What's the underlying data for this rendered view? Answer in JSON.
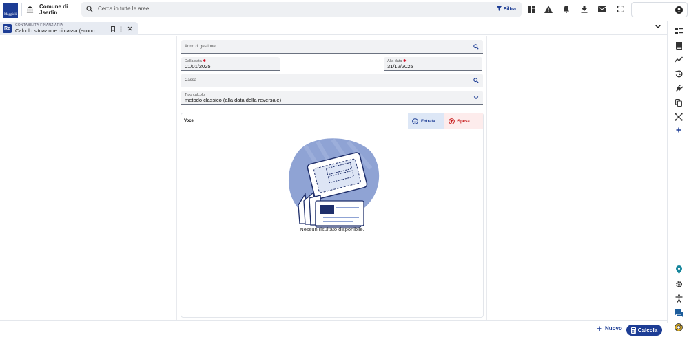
{
  "brand": {
    "logo_text": "Maggioli",
    "org_line1": "Comune di",
    "org_line2": "Jserfin"
  },
  "search": {
    "placeholder": "Cerca in tutte le aree...",
    "filter_label": "Filtra"
  },
  "tab": {
    "badge": "Re",
    "kicker": "CONTABILITÀ FINANZIARIA",
    "title": "Calcolo situazione di cassa (econo..."
  },
  "form": {
    "anno": {
      "label": "Anno di gestione",
      "value": ""
    },
    "dalla": {
      "label": "Dalla data",
      "value": "01/01/2025"
    },
    "alla": {
      "label": "Alla data",
      "value": "31/12/2025"
    },
    "cassa": {
      "label": "Cassa",
      "value": ""
    },
    "tipo": {
      "label": "Tipo calcolo",
      "value": "metodo classico (alla data della reversale)"
    }
  },
  "results": {
    "column_voce": "Voce",
    "toggle_entrata": "Entrata",
    "toggle_spesa": "Spesa",
    "empty_message": "Nessun risultato disponibile."
  },
  "actions": {
    "new_label": "Nuovo",
    "calc_label": "Calcola"
  },
  "colors": {
    "primary": "#1d3d95",
    "danger": "#c81e1e",
    "entrata_bg": "#dde7f6",
    "spesa_bg": "#fdecec"
  },
  "topbar_icons": [
    "dashboard-icon",
    "warning-icon",
    "bell-icon",
    "download-icon",
    "mail-icon",
    "fullscreen-icon",
    "user-icon"
  ],
  "rail_icons": [
    "list-icon",
    "book-icon",
    "chart-line-icon",
    "history-icon",
    "plug-icon",
    "copy-icon",
    "network-icon",
    "plus-icon",
    "location-icon",
    "settings-icon",
    "accessibility-icon",
    "chat-icon",
    "help-icon"
  ]
}
